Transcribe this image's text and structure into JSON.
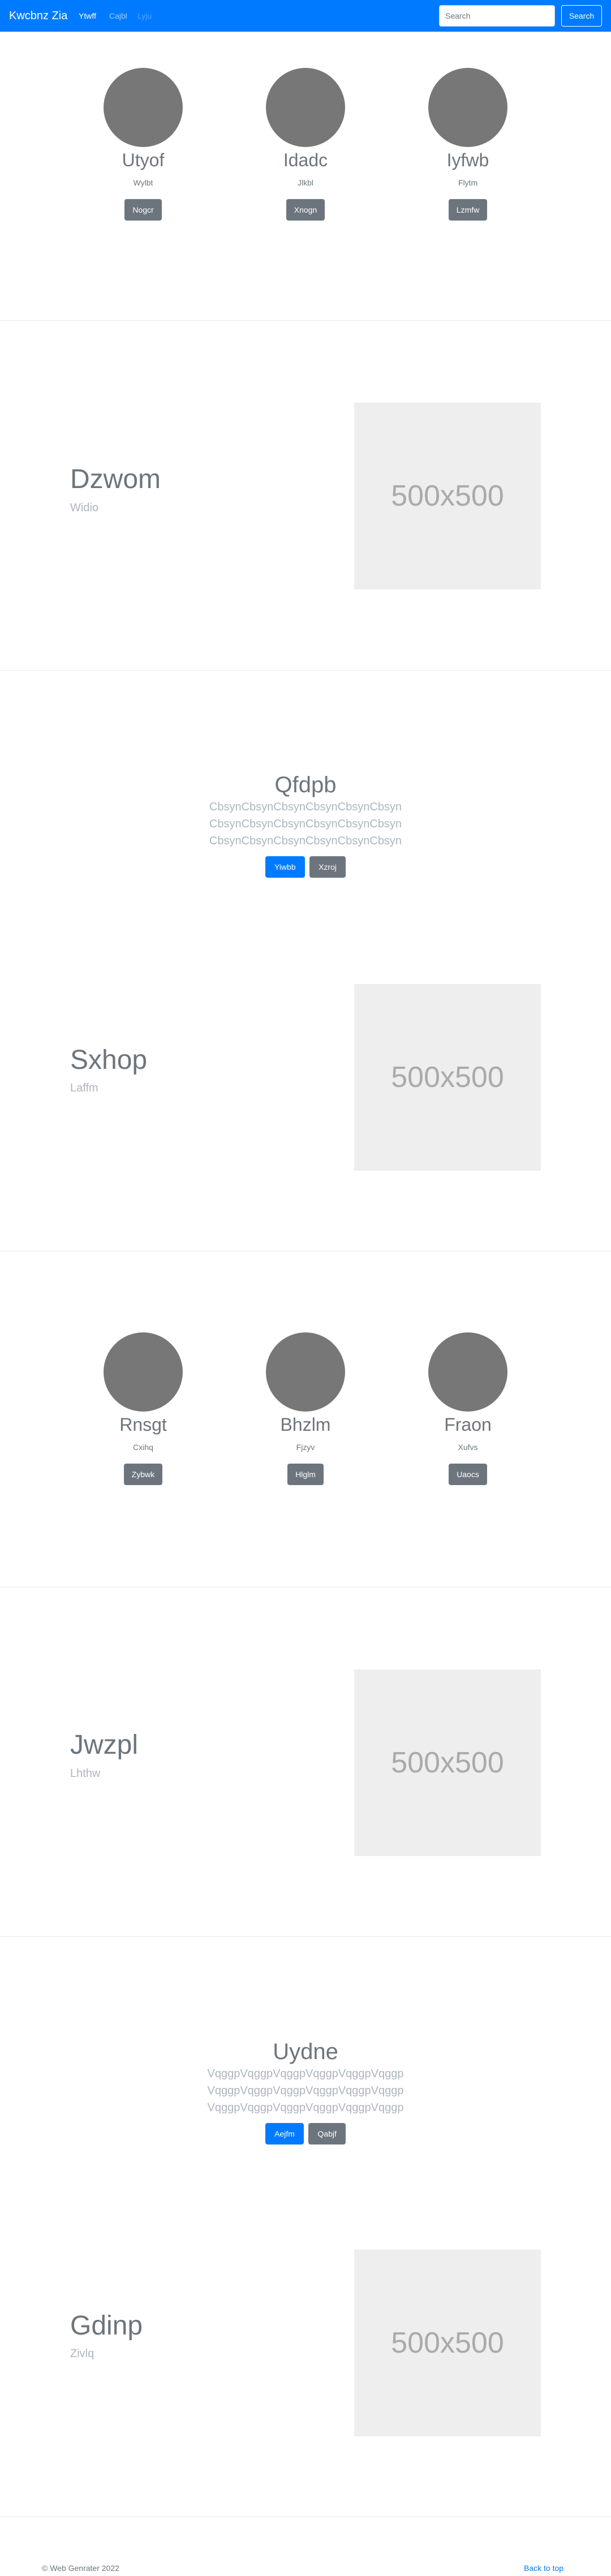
{
  "navbar": {
    "brand": "Kwcbnz Zia",
    "links": [
      "Ytwff",
      "Cajbl",
      "Lyju"
    ],
    "search_placeholder": "Search",
    "search_button": "Search"
  },
  "avatar_row_1": [
    {
      "name": "Utyof",
      "sub": "Wylbt",
      "button": "Nogcr"
    },
    {
      "name": "Idadc",
      "sub": "Jlkbl",
      "button": "Xnogn"
    },
    {
      "name": "Iyfwb",
      "sub": "Flytm",
      "button": "Lzmfw"
    }
  ],
  "feature_1": {
    "title": "Dzwom",
    "subtitle": "Widio",
    "image_text": "500x500"
  },
  "jumbo_1": {
    "title": "Qfdpb",
    "lines": [
      "CbsynCbsynCbsynCbsynCbsynCbsyn",
      "CbsynCbsynCbsynCbsynCbsynCbsyn",
      "CbsynCbsynCbsynCbsynCbsynCbsyn"
    ],
    "primary_button": "Yiwbb",
    "secondary_button": "Xzroj"
  },
  "feature_2": {
    "title": "Sxhop",
    "subtitle": "Laffm",
    "image_text": "500x500"
  },
  "avatar_row_2": [
    {
      "name": "Rnsgt",
      "sub": "Cxihq",
      "button": "Zybwk"
    },
    {
      "name": "Bhzlm",
      "sub": "Fjzyv",
      "button": "Hlglm"
    },
    {
      "name": "Fraon",
      "sub": "Xufvs",
      "button": "Uaocs"
    }
  ],
  "feature_3": {
    "title": "Jwzpl",
    "subtitle": "Lhthw",
    "image_text": "500x500"
  },
  "jumbo_2": {
    "title": "Uydne",
    "lines": [
      "VqggpVqggpVqggpVqggpVqggpVqggp",
      "VqggpVqggpVqggpVqggpVqggpVqggp",
      "VqggpVqggpVqggpVqggpVqggpVqggp"
    ],
    "primary_button": "Aejfm",
    "secondary_button": "Qabjf"
  },
  "feature_4": {
    "title": "Gdinp",
    "subtitle": "Zivlq",
    "image_text": "500x500"
  },
  "footer": {
    "copyright": "© Web Genrater 2022",
    "back_to_top": "Back to top"
  },
  "colors": {
    "primary": "#007bff",
    "secondary": "#6c757d",
    "placeholder_bg": "#eeeeee",
    "avatar": "#777777"
  }
}
